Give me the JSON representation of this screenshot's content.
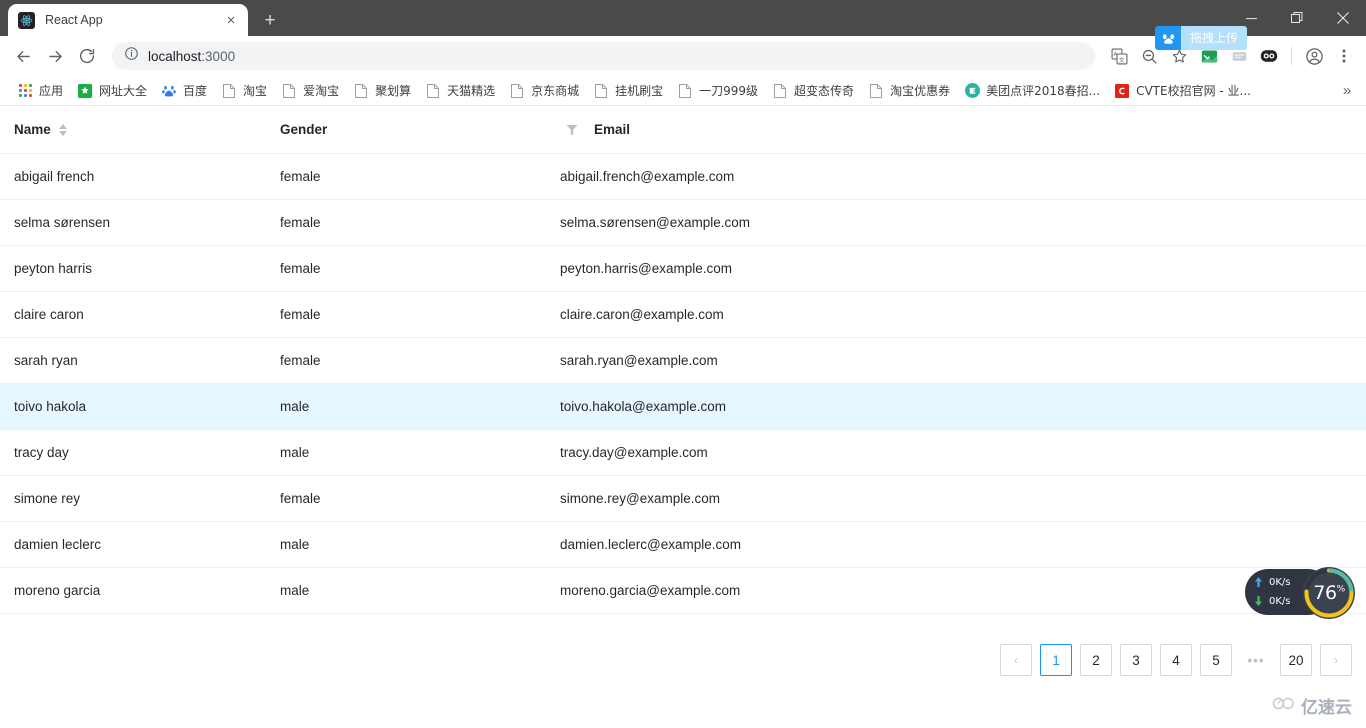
{
  "browser": {
    "tab": {
      "title": "React App",
      "favicon": "react-logo-icon",
      "close_label": "×"
    },
    "new_tab_label": "+",
    "window_controls": {
      "minimize": "—",
      "maximize": "❐",
      "close": "✕"
    },
    "nav": {
      "back": "←",
      "forward": "→",
      "reload": "⟳"
    },
    "omnibox": {
      "info_icon": "site-info-icon",
      "url_host": "localhost",
      "url_path": ":3000",
      "full_url": "localhost:3000"
    },
    "toolbar_icons": [
      "translate-icon",
      "zoom-out-icon",
      "bookmark-star-icon",
      "extension-green-icon",
      "extension-grey-icon",
      "extension-panda-icon",
      "profile-avatar-icon",
      "chrome-menu-icon"
    ],
    "netdisk_overlay": {
      "icon": "baidu-netdisk-icon",
      "label": "拖拽上传"
    }
  },
  "bookmarks": {
    "overflow_label": "»",
    "items": [
      {
        "label": "应用",
        "icon": "apps-grid-icon"
      },
      {
        "label": "网址大全",
        "icon": "hao123-icon"
      },
      {
        "label": "百度",
        "icon": "baidu-paw-icon"
      },
      {
        "label": "淘宝",
        "icon": "page-icon"
      },
      {
        "label": "爱淘宝",
        "icon": "page-icon"
      },
      {
        "label": "聚划算",
        "icon": "page-icon"
      },
      {
        "label": "天猫精选",
        "icon": "page-icon"
      },
      {
        "label": "京东商城",
        "icon": "page-icon"
      },
      {
        "label": "挂机刷宝",
        "icon": "page-icon"
      },
      {
        "label": "一刀999级",
        "icon": "page-icon"
      },
      {
        "label": "超变态传奇",
        "icon": "page-icon"
      },
      {
        "label": "淘宝优惠券",
        "icon": "page-icon"
      },
      {
        "label": "美团点评2018春招...",
        "icon": "meituan-icon"
      },
      {
        "label": "CVTE校招官网 - 业...",
        "icon": "cvte-icon"
      }
    ]
  },
  "table": {
    "columns": [
      {
        "key": "name",
        "label": "Name",
        "sortable": true,
        "sort_icon": "sort-caret-icon"
      },
      {
        "key": "gender",
        "label": "Gender",
        "filterable": true,
        "filter_icon": "filter-funnel-icon"
      },
      {
        "key": "email",
        "label": "Email"
      }
    ],
    "rows": [
      {
        "name": "abigail french",
        "gender": "female",
        "email": "abigail.french@example.com",
        "selected": false
      },
      {
        "name": "selma sørensen",
        "gender": "female",
        "email": "selma.sørensen@example.com",
        "selected": false
      },
      {
        "name": "peyton harris",
        "gender": "female",
        "email": "peyton.harris@example.com",
        "selected": false
      },
      {
        "name": "claire caron",
        "gender": "female",
        "email": "claire.caron@example.com",
        "selected": false
      },
      {
        "name": "sarah ryan",
        "gender": "female",
        "email": "sarah.ryan@example.com",
        "selected": false
      },
      {
        "name": "toivo hakola",
        "gender": "male",
        "email": "toivo.hakola@example.com",
        "selected": true
      },
      {
        "name": "tracy day",
        "gender": "male",
        "email": "tracy.day@example.com",
        "selected": false
      },
      {
        "name": "simone rey",
        "gender": "female",
        "email": "simone.rey@example.com",
        "selected": false
      },
      {
        "name": "damien leclerc",
        "gender": "male",
        "email": "damien.leclerc@example.com",
        "selected": false
      },
      {
        "name": "moreno garcia",
        "gender": "male",
        "email": "moreno.garcia@example.com",
        "selected": false
      }
    ]
  },
  "pagination": {
    "prev_label": "‹",
    "next_label": "›",
    "ellipsis": "•••",
    "pages": [
      "1",
      "2",
      "3",
      "4",
      "5"
    ],
    "last_page": "20",
    "current_page": "1",
    "active_color": "#1890ff"
  },
  "speed_widget": {
    "upload": "0K/s",
    "download": "0K/s",
    "upload_icon": "arrow-up-icon",
    "download_icon": "arrow-down-icon",
    "gauge_value": "76",
    "gauge_unit": "%",
    "gauge_percent": 76
  },
  "watermark": {
    "text": "亿速云",
    "icon": "cloud-logo-icon"
  },
  "colors": {
    "accent": "#1890ff",
    "row_selected": "#e6f7ff",
    "chrome_titlebar": "#4a4a4a",
    "border": "#f0f0f0",
    "netdisk_blue": "#2196f3"
  }
}
